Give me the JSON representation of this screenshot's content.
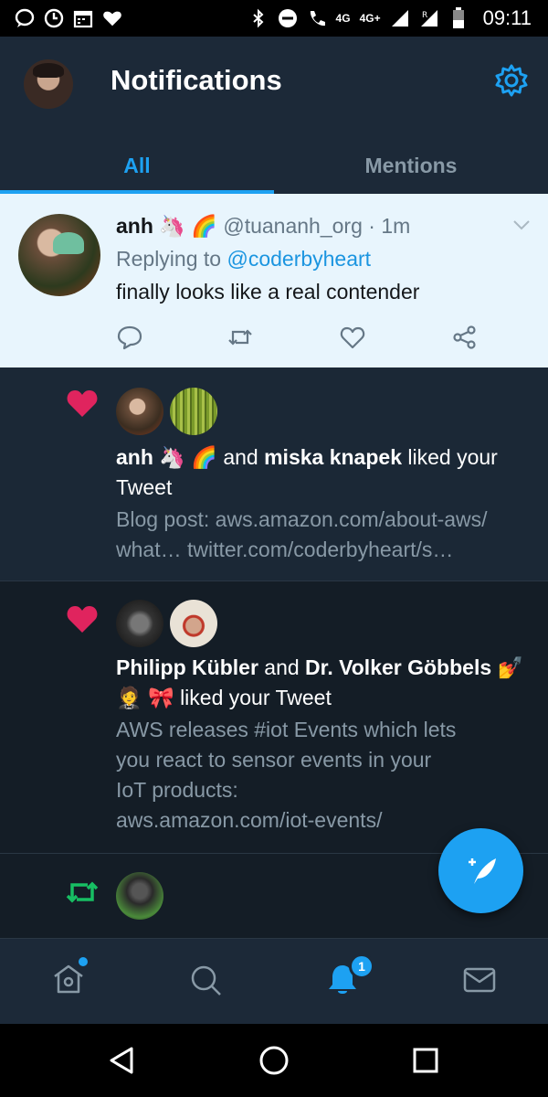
{
  "status_bar": {
    "network_label_1": "4G",
    "network_label_2": "4G+",
    "roaming": "R",
    "time": "09:11"
  },
  "header": {
    "title": "Notifications",
    "tabs": [
      {
        "label": "All",
        "active": true
      },
      {
        "label": "Mentions",
        "active": false
      }
    ],
    "accent": "#1da1f2"
  },
  "tweet": {
    "name": "anh",
    "name_emoji": "🦄 🌈",
    "handle": "@tuananh_org",
    "separator": "·",
    "time": "1m",
    "replying_prefix": "Replying to",
    "replying_to": "@coderbyheart",
    "text": "finally looks like a real contender"
  },
  "notifications": [
    {
      "type": "like",
      "user1": "anh",
      "user1_emoji": "🦄 🌈",
      "joiner": "and",
      "user2": "miska knapek",
      "action": "liked your Tweet",
      "preview_line1": "Blog post: aws.amazon.com/about-aws/",
      "preview_line2": "what… twitter.com/coderbyheart/s…"
    },
    {
      "type": "like",
      "user1": "Philipp Kübler",
      "joiner": "and",
      "user2": "Dr. Volker Göbbels",
      "user2_emoji_1": "💅",
      "user2_emoji_2": "🤵 🎀",
      "action": "liked your Tweet",
      "preview_line1": "AWS releases #iot Events which lets",
      "preview_line2": "you react to sensor events in your",
      "preview_line3": "IoT products:",
      "preview_line4": "aws.amazon.com/iot-events/"
    },
    {
      "type": "retweet"
    }
  ],
  "bottom_nav": {
    "notification_count": "1"
  },
  "colors": {
    "like": "#e0245e",
    "retweet": "#17bf63",
    "background": "#141d26",
    "header": "#1c2938"
  }
}
